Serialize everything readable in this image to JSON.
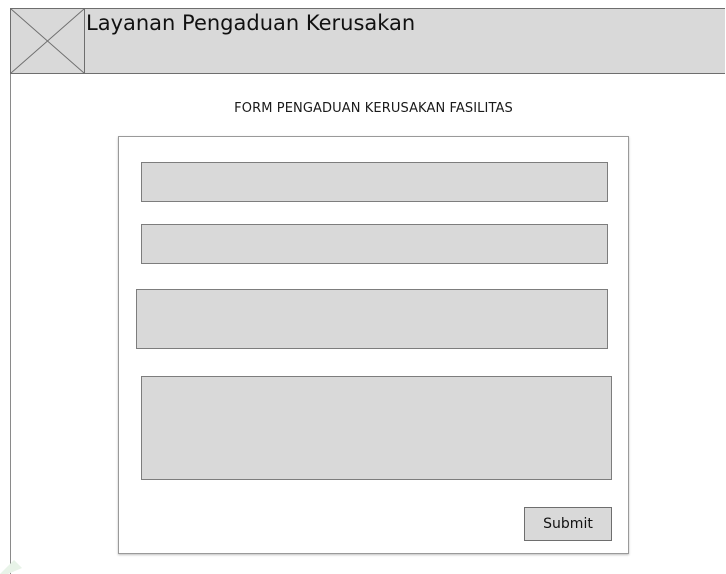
{
  "header": {
    "title": "Layanan Pengaduan Kerusakan",
    "logo_icon": "image-placeholder-icon"
  },
  "form": {
    "heading": "FORM PENGADUAN KERUSAKAN FASILITAS",
    "fields": [
      {
        "name": "field-1",
        "value": ""
      },
      {
        "name": "field-2",
        "value": ""
      },
      {
        "name": "field-3",
        "value": ""
      },
      {
        "name": "field-4",
        "value": ""
      }
    ],
    "submit_label": "Submit"
  },
  "colors": {
    "placeholder_fill": "#d9d9d9",
    "border": "#6e6e6e",
    "page_background": "#ffffff"
  }
}
